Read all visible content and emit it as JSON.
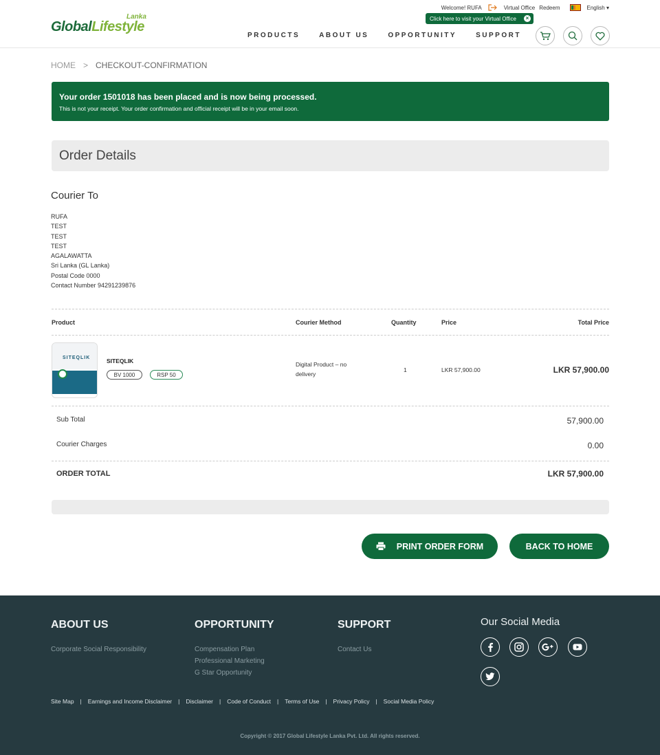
{
  "header": {
    "logo": {
      "main_a": "Global",
      "main_b": "Lifestyle",
      "sub": "Lanka"
    },
    "welcome": "Welcome! RUFA",
    "virtual_office": "Virtual Office",
    "redeem": "Redeem",
    "language": "English",
    "tooltip": "Click here to visit your Virtual Office",
    "nav": [
      "PRODUCTS",
      "ABOUT US",
      "OPPORTUNITY",
      "SUPPORT"
    ]
  },
  "breadcrumb": {
    "home": "HOME",
    "separator": ">",
    "current": "CHECKOUT-CONFIRMATION"
  },
  "alert": {
    "title": "Your order 1501018 has been placed and is now being processed.",
    "subtitle": "This is not your receipt. Your order confirmation and official receipt will be in your email soon."
  },
  "order_details": {
    "title": "Order Details"
  },
  "courier": {
    "title": "Courier To",
    "lines": [
      "RUFA",
      "TEST",
      "TEST",
      "TEST",
      "AGALAWATTA",
      "Sri Lanka (GL Lanka)",
      "Postal Code 0000",
      "Contact Number 94291239876"
    ]
  },
  "table": {
    "headers": {
      "product": "Product",
      "courier_method": "Courier Method",
      "quantity": "Quantity",
      "price": "Price",
      "total_price": "Total Price"
    },
    "rows": [
      {
        "image_text": "SITEQLIK",
        "name": "SITEQLIK",
        "bv": "BV 1000",
        "rsp": "RSP 50",
        "courier_method": "Digital Product – no delivery",
        "quantity": "1",
        "price": "LKR 57,900.00",
        "total": "LKR 57,900.00"
      }
    ]
  },
  "summary": {
    "sub_total_label": "Sub Total",
    "sub_total": "57,900.00",
    "courier_label": "Courier Charges",
    "courier_charges": "0.00",
    "order_total_label": "ORDER TOTAL",
    "order_total": "LKR 57,900.00"
  },
  "buttons": {
    "print": "PRINT ORDER FORM",
    "home": "BACK TO HOME"
  },
  "footer": {
    "about": {
      "title": "ABOUT US",
      "links": [
        "Corporate Social Responsibility"
      ]
    },
    "opportunity": {
      "title": "OPPORTUNITY",
      "links": [
        "Compensation Plan",
        "Professional Marketing",
        "G Star Opportunity"
      ]
    },
    "support": {
      "title": "SUPPORT",
      "links": [
        "Contact Us"
      ]
    },
    "social_title": "Our Social Media",
    "social": [
      "facebook-icon",
      "instagram-icon",
      "google-plus-icon",
      "youtube-icon",
      "twitter-icon"
    ],
    "bottom_links": [
      "Site Map",
      "Earnings and Income Disclaimer",
      "Disclaimer",
      "Code of Conduct",
      "Terms of Use",
      "Privacy Policy",
      "Social Media Policy"
    ],
    "link_separator": "|",
    "copyright": "Copyright © 2017 Global Lifestyle Lanka Pvt. Ltd. All rights reserved."
  },
  "colors": {
    "brand_green": "#0f6a3b",
    "logo_light_green": "#7fb33a",
    "footer_bg": "#263a40"
  }
}
